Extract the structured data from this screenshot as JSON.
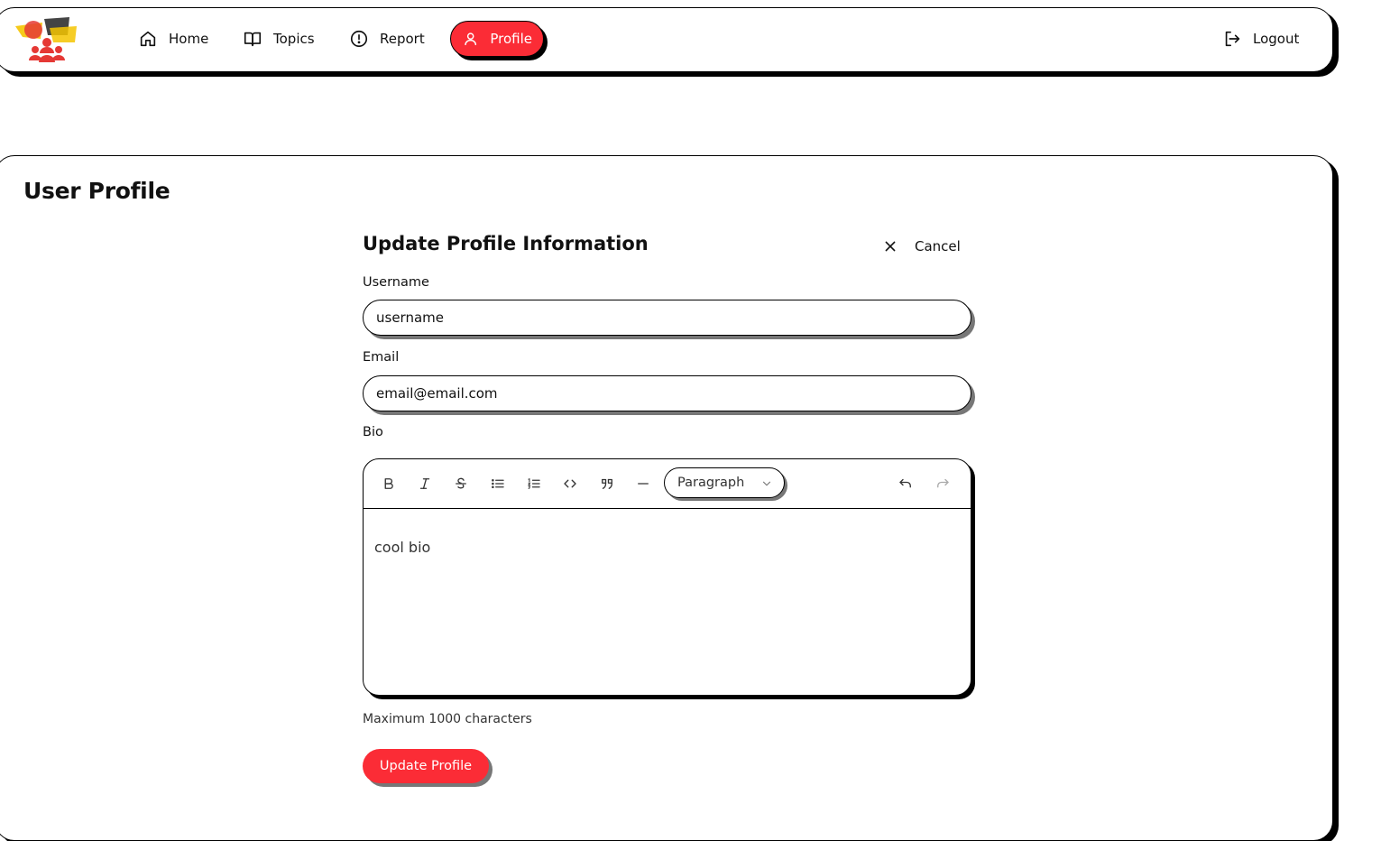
{
  "nav": {
    "logo_icon": "community-logo-icon",
    "items": [
      {
        "label": "Home",
        "icon": "home-icon"
      },
      {
        "label": "Topics",
        "icon": "book-icon"
      },
      {
        "label": "Report",
        "icon": "alert-circle-icon"
      },
      {
        "label": "Profile",
        "icon": "user-icon",
        "active": true
      }
    ],
    "logout": {
      "label": "Logout",
      "icon": "logout-icon"
    }
  },
  "page": {
    "title": "User Profile"
  },
  "form": {
    "title": "Update Profile Information",
    "cancel_label": "Cancel",
    "username": {
      "label": "Username",
      "value": "username"
    },
    "email": {
      "label": "Email",
      "value": "email@email.com"
    },
    "bio": {
      "label": "Bio",
      "content": "cool bio",
      "block_type": "Paragraph",
      "toolbar": [
        "bold-icon",
        "italic-icon",
        "strikethrough-icon",
        "bullet-list-icon",
        "ordered-list-icon",
        "code-icon",
        "quote-icon",
        "horizontal-rule-icon",
        "undo-icon",
        "redo-icon"
      ]
    },
    "hint": "Maximum 1000 characters",
    "submit_label": "Update Profile"
  },
  "colors": {
    "accent": "#fb2c36",
    "border": "#000000",
    "shadow_muted": "#777777"
  }
}
